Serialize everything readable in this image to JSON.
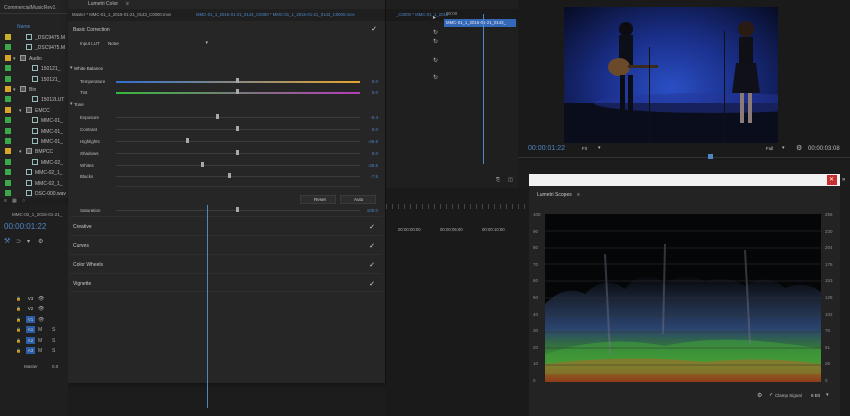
{
  "project": {
    "title": "CommercialMusicRev1",
    "name_header": "Name",
    "items": [
      {
        "label": "_DSC9475.M",
        "sw": "#c7b02b",
        "indent": 28,
        "kind": "clip",
        "tri": ""
      },
      {
        "label": "_DSC9475.M",
        "sw": "#3ba84a",
        "indent": 28,
        "kind": "clip",
        "tri": ""
      },
      {
        "label": "Audio",
        "sw": "#d6a52a",
        "indent": 22,
        "kind": "folder",
        "tri": "▾"
      },
      {
        "label": "150121_",
        "sw": "#3ba84a",
        "indent": 34,
        "kind": "clip",
        "tri": ""
      },
      {
        "label": "150121_",
        "sw": "#3ba84a",
        "indent": 34,
        "kind": "clip",
        "tri": ""
      },
      {
        "label": "Bin",
        "sw": "#d6a52a",
        "indent": 22,
        "kind": "folder",
        "tri": "▾"
      },
      {
        "label": "15012LUT",
        "sw": "#3ba84a",
        "indent": 34,
        "kind": "clip",
        "tri": ""
      },
      {
        "label": "EMCC",
        "sw": "#d6a52a",
        "indent": 28,
        "kind": "folder",
        "tri": "▾"
      },
      {
        "label": "MMC-01_",
        "sw": "#3ba84a",
        "indent": 34,
        "kind": "clip",
        "tri": ""
      },
      {
        "label": "MMC-01_",
        "sw": "#3ba84a",
        "indent": 34,
        "kind": "clip",
        "tri": ""
      },
      {
        "label": "MMC-01_",
        "sw": "#3ba84a",
        "indent": 34,
        "kind": "clip",
        "tri": ""
      },
      {
        "label": "BMPCC",
        "sw": "#d6a52a",
        "indent": 28,
        "kind": "folder",
        "tri": "▾"
      },
      {
        "label": "MMC-02_",
        "sw": "#3ba84a",
        "indent": 34,
        "kind": "clip",
        "tri": ""
      },
      {
        "label": "MMC-02_1_",
        "sw": "#3ba84a",
        "indent": 28,
        "kind": "clip",
        "tri": ""
      },
      {
        "label": "MMC-02_1_",
        "sw": "#3ba84a",
        "indent": 28,
        "kind": "clip",
        "tri": ""
      },
      {
        "label": "DSC-000.wav",
        "sw": "#3ba84a",
        "indent": 28,
        "kind": "clip",
        "tri": ""
      }
    ]
  },
  "lumetri": {
    "title": "Lumetri Color",
    "clip_tab": "Master * MMC-01_1_2015-01-21_0143_C0000.mov",
    "seq_tab": "MMC-01_1_2015-01-21_0143_C0000 * MMC-01_1_2015-01-21_0143_C0000.mov",
    "basic_correction": "Basic Correction",
    "input_lut_label": "Input LUT",
    "input_lut_value": "None",
    "white_balance": "White Balance",
    "temperature_label": "Temperature",
    "temperature_value": "0.0",
    "tint_label": "Tint",
    "tint_value": "0.0",
    "tone": "Tone",
    "exposure_label": "Exposure",
    "exposure_value": "-0.4",
    "contrast_label": "Contrast",
    "contrast_value": "0.0",
    "highlights_label": "Highlights",
    "highlights_value": "-46.8",
    "shadows_label": "Shadows",
    "shadows_value": "0.0",
    "whites_label": "Whites",
    "whites_value": "-26.6",
    "blacks_label": "Blacks",
    "blacks_value": "-7.5",
    "reset_label": "Reset",
    "auto_label": "Auto",
    "saturation_label": "Saturation",
    "saturation_value": "100.0",
    "creative_label": "Creative",
    "curves_label": "Curves",
    "color_wheels_label": "Color Wheels",
    "vignette_label": "Vignette",
    "check": "✓"
  },
  "sources": {
    "clip_name": "MMC-01_1_2015-01-21_0143_",
    "tab_fragment": "_C0000 * MMC-01_1_2015",
    "time_zero": "00:00"
  },
  "timeline": {
    "seq_name": "MMC-02_1_2015-01-21_",
    "timecode": "00:00:01:22",
    "ruler": [
      "00:00:00:00",
      "00:00:05:00",
      "00:00:10:00"
    ],
    "master_label": "Master",
    "master_value": "0.0",
    "tracks": [
      {
        "name": "V3",
        "blue": false,
        "eye": "👁",
        "s": ""
      },
      {
        "name": "V2",
        "blue": false,
        "eye": "👁",
        "s": ""
      },
      {
        "name": "V1",
        "blue": true,
        "eye": "👁",
        "s": ""
      },
      {
        "name": "A1",
        "blue": true,
        "eye": "M",
        "s": "S"
      },
      {
        "name": "A2",
        "blue": true,
        "eye": "M",
        "s": "S"
      },
      {
        "name": "A3",
        "blue": true,
        "eye": "M",
        "s": "S"
      }
    ]
  },
  "program": {
    "timecode": "00:00:01:22",
    "fit_label": "Fit",
    "full_label": "Full",
    "duration": "00:00:03:08"
  },
  "scopes": {
    "title": "Lumetri Scopes",
    "close": "✕",
    "left_scale": [
      "100",
      "90",
      "80",
      "70",
      "60",
      "50",
      "40",
      "30",
      "20",
      "10",
      "0"
    ],
    "right_scale": [
      "255",
      "230",
      "204",
      "178",
      "153",
      "128",
      "102",
      "76",
      "51",
      "26",
      "0"
    ],
    "clamp_label": "Clamp Signal",
    "bit_label": "8 Bit"
  },
  "colors": {
    "accent_blue": "#4f86c6",
    "temperature_gradient": "linear-gradient(90deg,#2f6fd1,#e6a52e)",
    "tint_gradient": "linear-gradient(90deg,#38b83c,#b63cb8)"
  }
}
